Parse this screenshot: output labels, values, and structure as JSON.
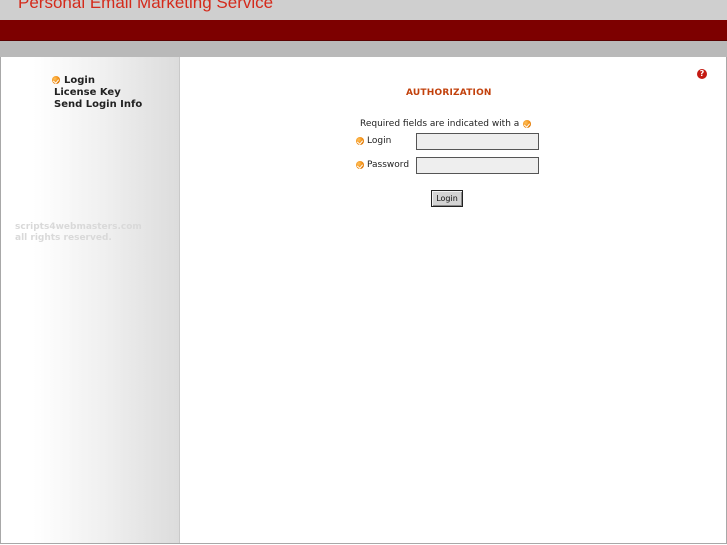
{
  "header": {
    "site_title": "Personal Email Marketing Service"
  },
  "sidebar": {
    "items": [
      {
        "label": "Login",
        "active": true
      },
      {
        "label": "License Key",
        "active": false
      },
      {
        "label": "Send Login Info",
        "active": false
      }
    ],
    "copyright_line1": "scripts4webmasters.com",
    "copyright_line2": "all rights reserved."
  },
  "help": {
    "glyph": "?"
  },
  "main": {
    "title": "AUTHORIZATION",
    "required_note": "Required fields are indicated with a",
    "fields": {
      "login": {
        "label": "Login",
        "value": ""
      },
      "password": {
        "label": "Password",
        "value": ""
      }
    },
    "submit_label": "Login"
  },
  "colors": {
    "header_red_band": "#7d0000",
    "title_red": "#d42a1b",
    "accent_orange": "#f08a10",
    "auth_title": "#c2410c",
    "help_icon": "#c41a12"
  },
  "icons": {
    "nav_bullet": "orange-check-bullet-icon",
    "help": "help-question-icon"
  }
}
